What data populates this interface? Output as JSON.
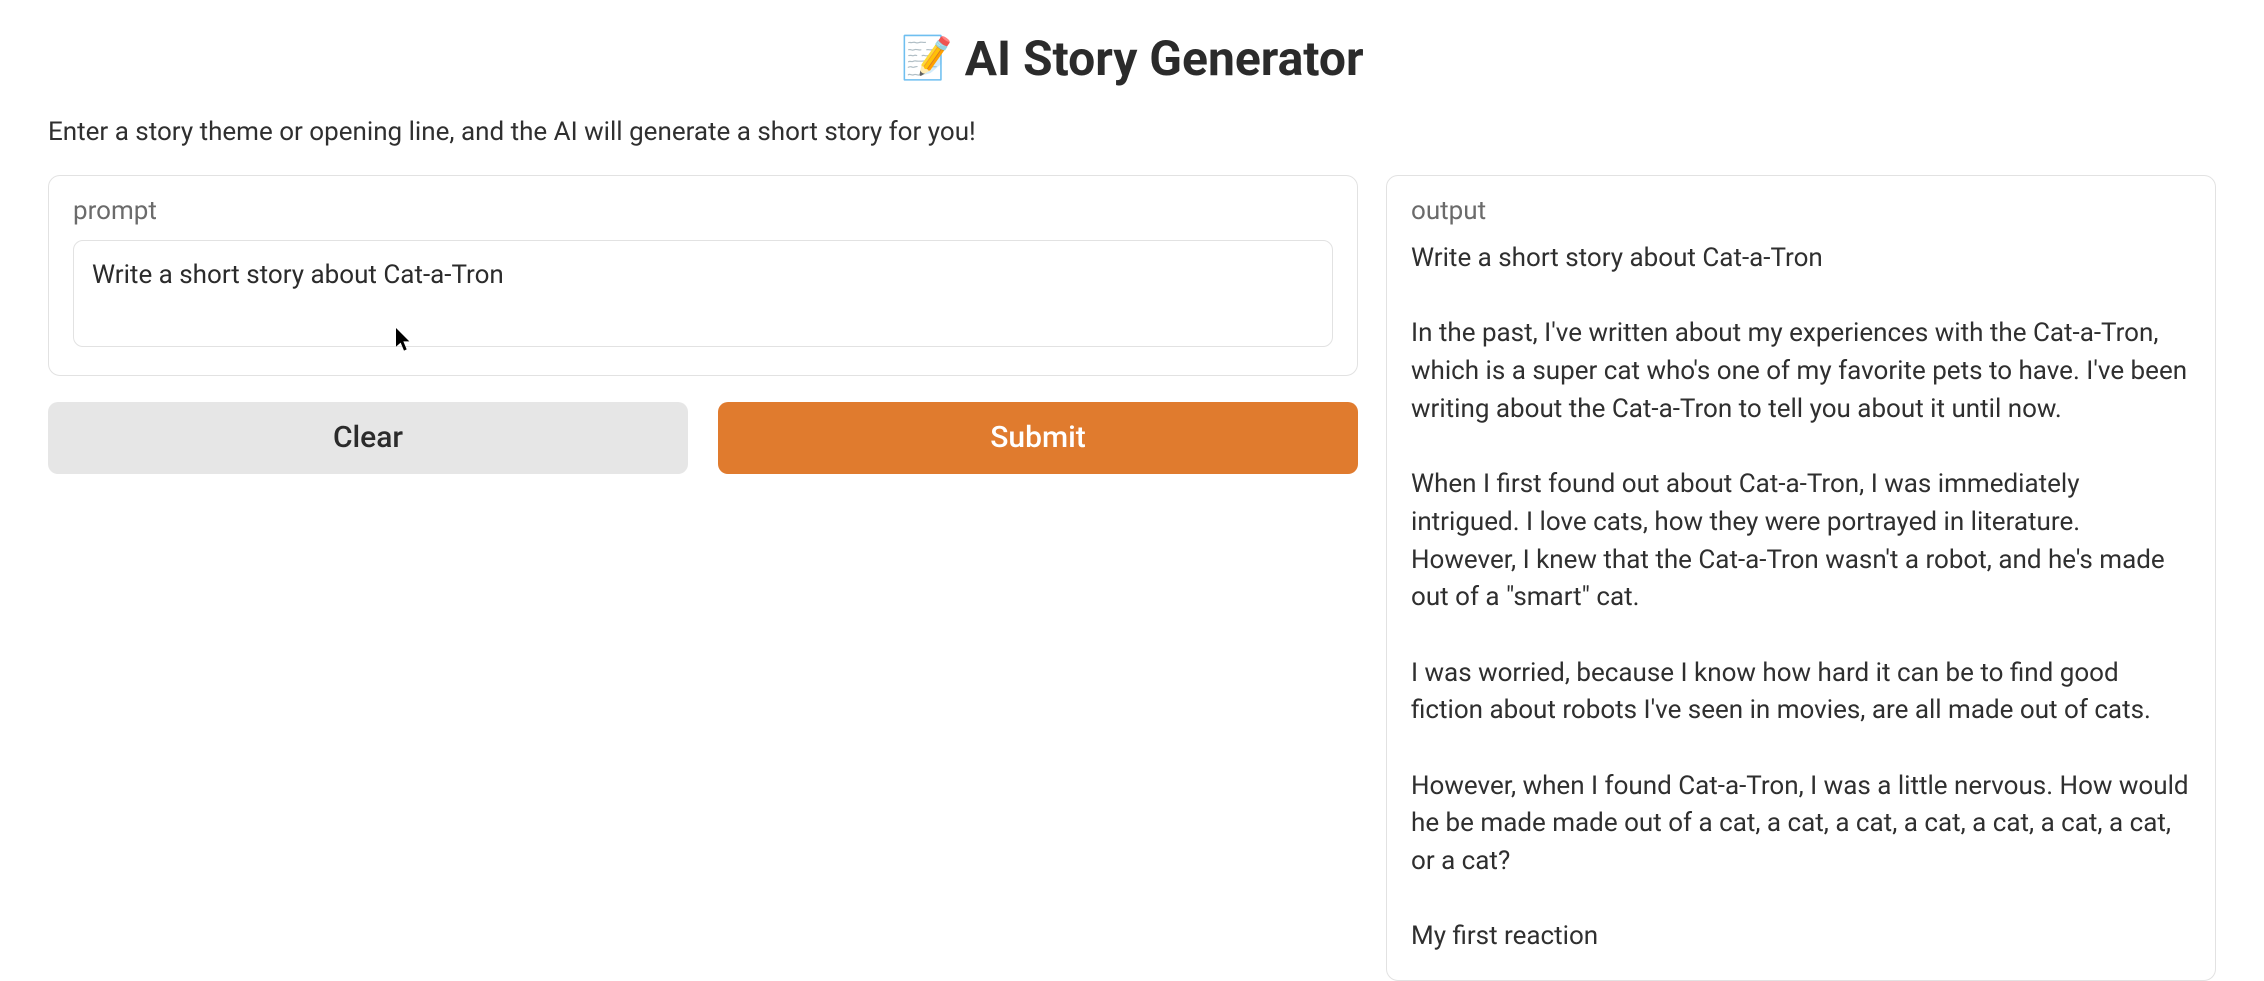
{
  "header": {
    "icon": "📝",
    "title": "AI Story Generator"
  },
  "subtitle": "Enter a story theme or opening line, and the AI will generate a short story for you!",
  "prompt": {
    "label": "prompt",
    "value": "Write a short story about Cat-a-Tron"
  },
  "buttons": {
    "clear": "Clear",
    "submit": "Submit"
  },
  "output": {
    "label": "output",
    "text": "Write a short story about Cat-a-Tron\n\nIn the past, I've written about my experiences with the Cat-a-Tron, which is a super cat who's one of my favorite pets to have. I've been writing about the Cat-a-Tron to tell you about it until now.\n\nWhen I first found out about Cat-a-Tron, I was immediately intrigued. I love cats, how they were portrayed in literature. However, I knew that the Cat-a-Tron wasn't a robot, and he's made out of a \"smart\" cat.\n\nI was worried, because I know how hard it can be to find good fiction about robots I've seen in movies, are all made out of cats.\n\nHowever, when I found Cat-a-Tron, I was a little nervous. How would he be made made out of a cat, a cat, a cat, a cat, a cat, a cat, a cat, or a cat?\n\nMy first reaction"
  }
}
